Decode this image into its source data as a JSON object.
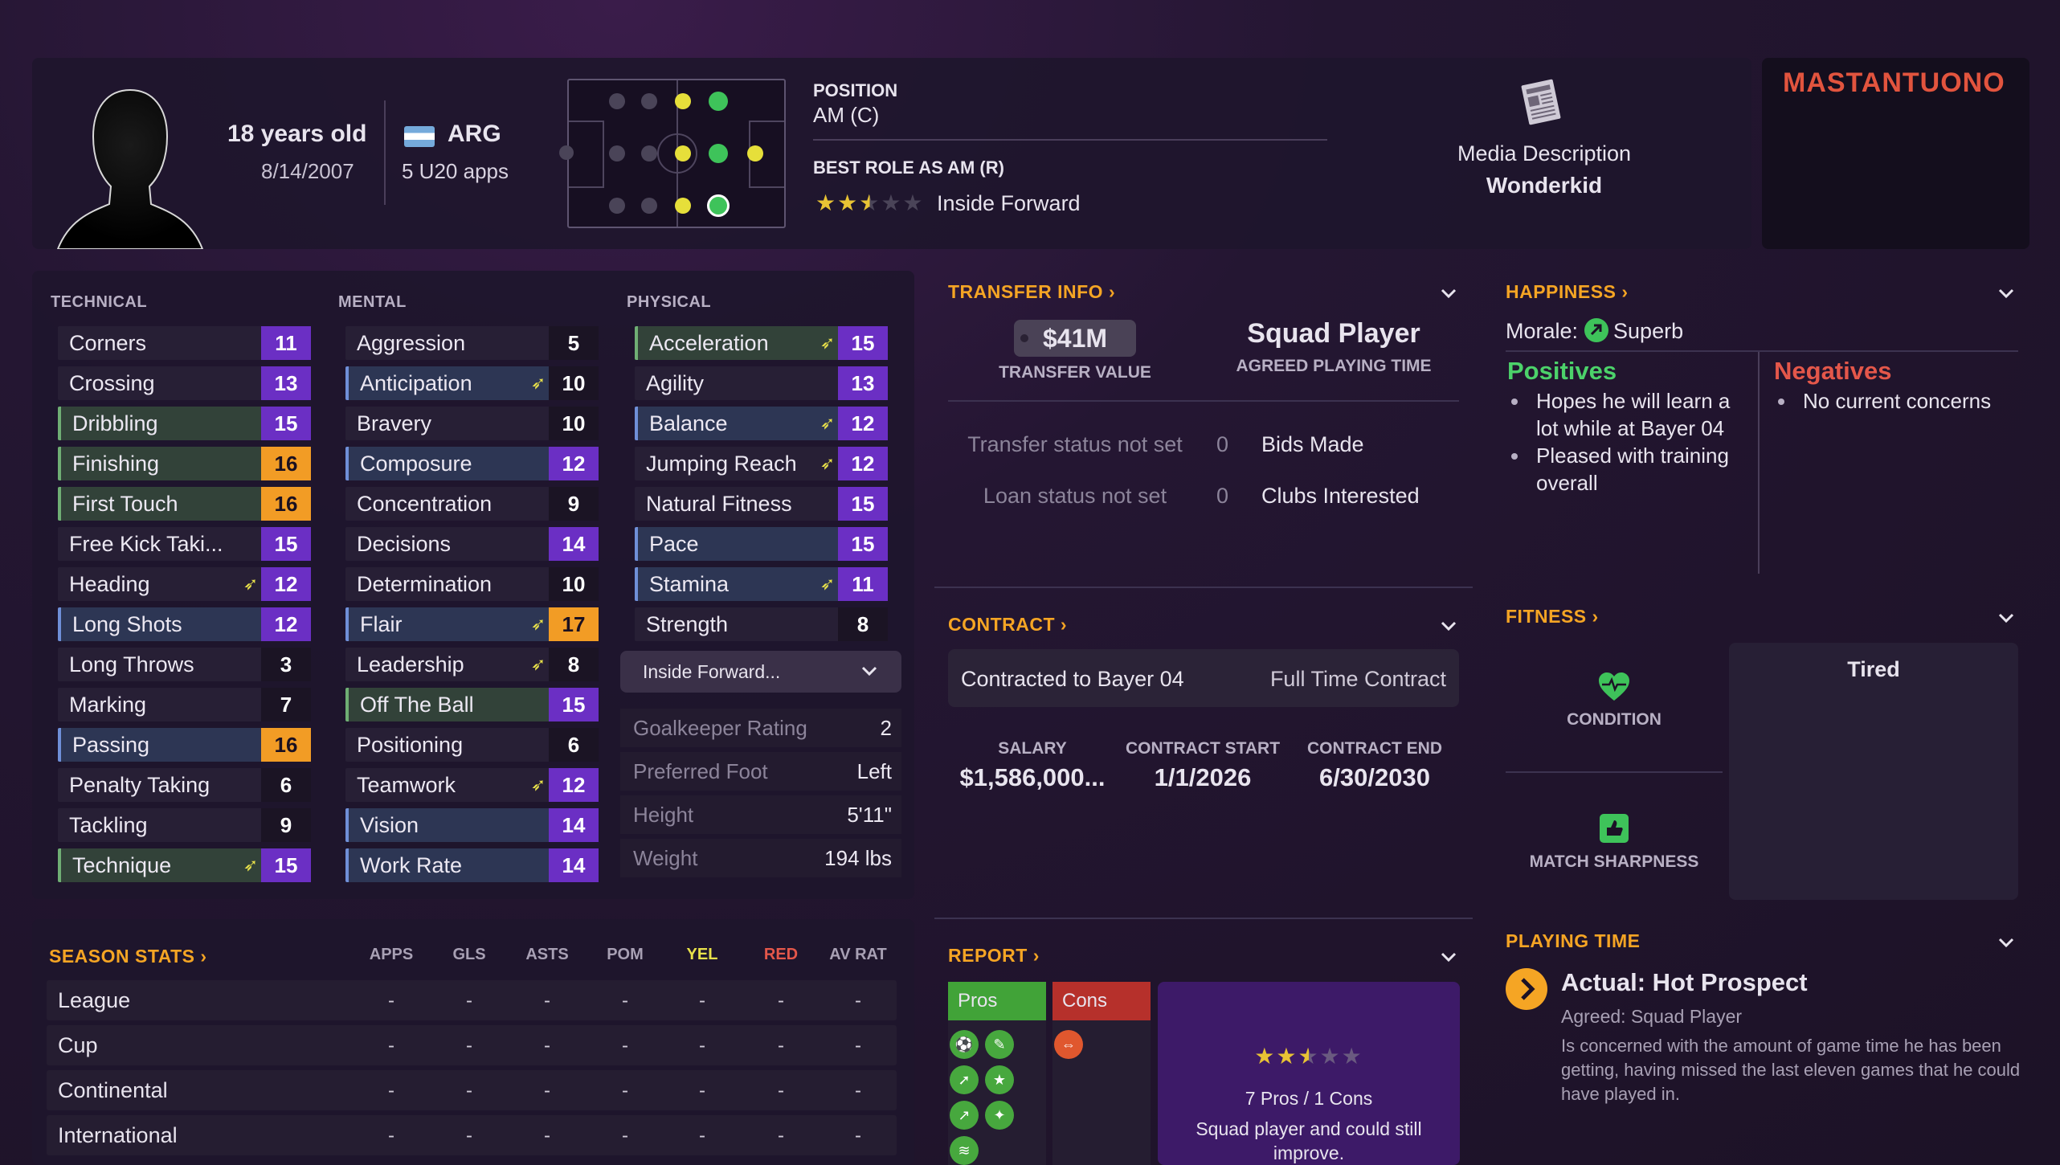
{
  "header": {
    "age": "18 years old",
    "dob": "8/14/2007",
    "nation": "ARG",
    "apps": "5 U20 apps",
    "position_label": "POSITION",
    "position_value": "AM (C)",
    "best_role_label": "BEST ROLE AS AM (R)",
    "best_role_value": "Inside Forward",
    "best_role_stars": 2.5,
    "media_label": "Media Description",
    "media_value": "Wonderkid",
    "player_name": "MASTANTUONO"
  },
  "attributes": {
    "technical_title": "TECHNICAL",
    "mental_title": "MENTAL",
    "physical_title": "PHYSICAL",
    "technical": [
      {
        "name": "Corners",
        "value": "11",
        "tone": "purple",
        "hl": "",
        "arrow": false
      },
      {
        "name": "Crossing",
        "value": "13",
        "tone": "purple",
        "hl": "",
        "arrow": false
      },
      {
        "name": "Dribbling",
        "value": "15",
        "tone": "purple",
        "hl": "green",
        "arrow": false
      },
      {
        "name": "Finishing",
        "value": "16",
        "tone": "orange",
        "hl": "green",
        "arrow": false
      },
      {
        "name": "First Touch",
        "value": "16",
        "tone": "orange",
        "hl": "green",
        "arrow": false
      },
      {
        "name": "Free Kick Taki...",
        "value": "15",
        "tone": "purple",
        "hl": "",
        "arrow": false
      },
      {
        "name": "Heading",
        "value": "12",
        "tone": "purple",
        "hl": "",
        "arrow": true
      },
      {
        "name": "Long Shots",
        "value": "12",
        "tone": "purple",
        "hl": "blue",
        "arrow": false
      },
      {
        "name": "Long Throws",
        "value": "3",
        "tone": "dark",
        "hl": "",
        "arrow": false
      },
      {
        "name": "Marking",
        "value": "7",
        "tone": "dark",
        "hl": "",
        "arrow": false
      },
      {
        "name": "Passing",
        "value": "16",
        "tone": "orange",
        "hl": "blue",
        "arrow": false
      },
      {
        "name": "Penalty Taking",
        "value": "6",
        "tone": "dark",
        "hl": "",
        "arrow": false
      },
      {
        "name": "Tackling",
        "value": "9",
        "tone": "dark",
        "hl": "",
        "arrow": false
      },
      {
        "name": "Technique",
        "value": "15",
        "tone": "purple",
        "hl": "green",
        "arrow": true
      }
    ],
    "mental": [
      {
        "name": "Aggression",
        "value": "5",
        "tone": "dark",
        "hl": "",
        "arrow": false
      },
      {
        "name": "Anticipation",
        "value": "10",
        "tone": "dark",
        "hl": "blue",
        "arrow": true
      },
      {
        "name": "Bravery",
        "value": "10",
        "tone": "dark",
        "hl": "",
        "arrow": false
      },
      {
        "name": "Composure",
        "value": "12",
        "tone": "purple",
        "hl": "blue",
        "arrow": false
      },
      {
        "name": "Concentration",
        "value": "9",
        "tone": "dark",
        "hl": "",
        "arrow": false
      },
      {
        "name": "Decisions",
        "value": "14",
        "tone": "purple",
        "hl": "",
        "arrow": false
      },
      {
        "name": "Determination",
        "value": "10",
        "tone": "dark",
        "hl": "",
        "arrow": false
      },
      {
        "name": "Flair",
        "value": "17",
        "tone": "orange",
        "hl": "blue",
        "arrow": true
      },
      {
        "name": "Leadership",
        "value": "8",
        "tone": "dark",
        "hl": "",
        "arrow": true
      },
      {
        "name": "Off The Ball",
        "value": "15",
        "tone": "purple",
        "hl": "green",
        "arrow": false
      },
      {
        "name": "Positioning",
        "value": "6",
        "tone": "dark",
        "hl": "",
        "arrow": false
      },
      {
        "name": "Teamwork",
        "value": "12",
        "tone": "purple",
        "hl": "",
        "arrow": true
      },
      {
        "name": "Vision",
        "value": "14",
        "tone": "purple",
        "hl": "blue",
        "arrow": false
      },
      {
        "name": "Work Rate",
        "value": "14",
        "tone": "purple",
        "hl": "blue",
        "arrow": false
      }
    ],
    "physical": [
      {
        "name": "Acceleration",
        "value": "15",
        "tone": "purple",
        "hl": "green",
        "arrow": true
      },
      {
        "name": "Agility",
        "value": "13",
        "tone": "purple",
        "hl": "",
        "arrow": false
      },
      {
        "name": "Balance",
        "value": "12",
        "tone": "purple",
        "hl": "blue",
        "arrow": true
      },
      {
        "name": "Jumping Reach",
        "value": "12",
        "tone": "purple",
        "hl": "",
        "arrow": true
      },
      {
        "name": "Natural Fitness",
        "value": "15",
        "tone": "purple",
        "hl": "",
        "arrow": false
      },
      {
        "name": "Pace",
        "value": "15",
        "tone": "purple",
        "hl": "blue",
        "arrow": false
      },
      {
        "name": "Stamina",
        "value": "11",
        "tone": "purple",
        "hl": "blue",
        "arrow": true
      },
      {
        "name": "Strength",
        "value": "8",
        "tone": "dark",
        "hl": "",
        "arrow": false
      }
    ],
    "role_dropdown": "Inside Forward...",
    "info": [
      {
        "k": "Goalkeeper Rating",
        "v": "2"
      },
      {
        "k": "Preferred Foot",
        "v": "Left"
      },
      {
        "k": "Height",
        "v": "5'11\""
      },
      {
        "k": "Weight",
        "v": "194 lbs"
      }
    ]
  },
  "season_stats": {
    "title": "SEASON STATS",
    "columns": [
      "APPS",
      "GLS",
      "ASTS",
      "POM",
      "YEL",
      "RED",
      "AV RAT"
    ],
    "rows": [
      {
        "label": "League",
        "cells": [
          "-",
          "-",
          "-",
          "-",
          "-",
          "-",
          "-"
        ]
      },
      {
        "label": "Cup",
        "cells": [
          "-",
          "-",
          "-",
          "-",
          "-",
          "-",
          "-"
        ]
      },
      {
        "label": "Continental",
        "cells": [
          "-",
          "-",
          "-",
          "-",
          "-",
          "-",
          "-"
        ]
      },
      {
        "label": "International",
        "cells": [
          "-",
          "-",
          "-",
          "-",
          "-",
          "-",
          "-"
        ]
      }
    ]
  },
  "transfer": {
    "title": "TRANSFER INFO",
    "value": "$41M",
    "value_label": "TRANSFER VALUE",
    "playing_time": "Squad Player",
    "playing_time_label": "AGREED PLAYING TIME",
    "rows": [
      {
        "status": "Transfer status not set",
        "count": "0",
        "label": "Bids Made"
      },
      {
        "status": "Loan status not set",
        "count": "0",
        "label": "Clubs Interested"
      }
    ]
  },
  "contract": {
    "title": "CONTRACT",
    "club": "Contracted to Bayer 04",
    "type": "Full Time Contract",
    "salary_label": "SALARY",
    "salary": "$1,586,000...",
    "start_label": "CONTRACT START",
    "start": "1/1/2026",
    "end_label": "CONTRACT END",
    "end": "6/30/2030"
  },
  "report": {
    "title": "REPORT",
    "pros_label": "Pros",
    "cons_label": "Cons",
    "stars": 2.5,
    "count": "7 Pros / 1 Cons",
    "summary": "Squad player and could still improve."
  },
  "happiness": {
    "title": "HAPPINESS",
    "morale_label": "Morale:",
    "morale_value": "Superb",
    "positives_title": "Positives",
    "positives": [
      "Hopes he will learn a lot while at Bayer 04",
      "Pleased with training overall"
    ],
    "negatives_title": "Negatives",
    "negatives": [
      "No current concerns"
    ]
  },
  "fitness": {
    "title": "FITNESS",
    "condition_label": "CONDITION",
    "sharpness_label": "MATCH SHARPNESS",
    "status": "Tired"
  },
  "playing_time": {
    "title": "PLAYING TIME",
    "actual": "Actual: Hot Prospect",
    "agreed": "Agreed: Squad Player",
    "description": "Is concerned with the amount of game time he has been getting, having missed the last eleven games that he could have played in."
  },
  "colors": {
    "accent": "#f5a524",
    "purple": "#6b2fc4",
    "orange": "#f29c25",
    "positive": "#4cd26a",
    "negative": "#e4574a",
    "name": "#e2543e"
  }
}
